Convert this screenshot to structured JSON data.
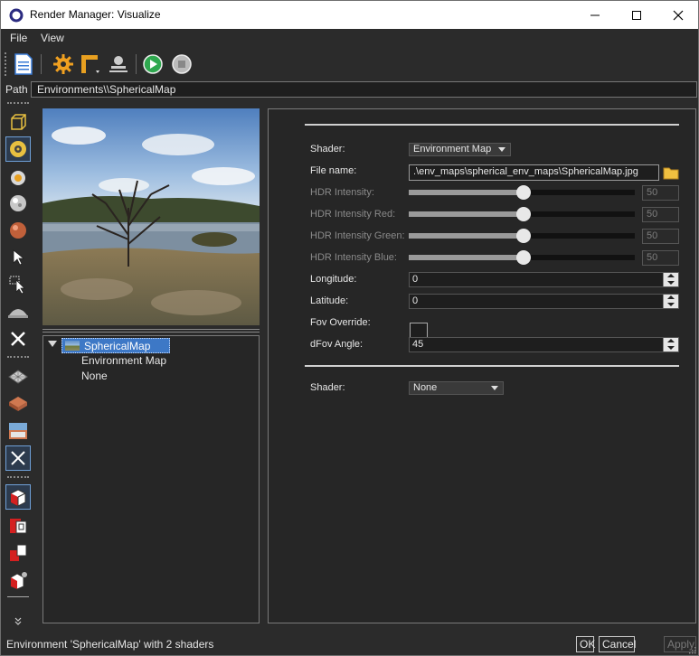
{
  "window": {
    "title": "Render Manager: Visualize",
    "minimize_glyph": "—",
    "maximize_glyph": "☐",
    "close_glyph": "✕"
  },
  "menu": {
    "file": "File",
    "view": "View"
  },
  "toolbar": {
    "icons": [
      "document-icon",
      "gear-icon",
      "frame-icon",
      "stamp-icon",
      "play-icon",
      "stop-icon"
    ]
  },
  "path": {
    "label": "Path",
    "value": "Environments\\\\SphericalMap"
  },
  "tree": {
    "root": "SphericalMap",
    "children": [
      "Environment Map",
      "None"
    ]
  },
  "properties": {
    "shader_label": "Shader:",
    "shader_value": "Environment Map",
    "filename_label": "File name:",
    "filename_value": ".\\env_maps\\spherical_env_maps\\SphericalMap.jpg",
    "hdr": [
      {
        "label": "HDR Intensity:",
        "value": "50",
        "fraction": 0.5
      },
      {
        "label": "HDR Intensity Red:",
        "value": "50",
        "fraction": 0.5
      },
      {
        "label": "HDR Intensity Green:",
        "value": "50",
        "fraction": 0.5
      },
      {
        "label": "HDR Intensity Blue:",
        "value": "50",
        "fraction": 0.5
      }
    ],
    "longitude_label": "Longitude:",
    "longitude_value": "0",
    "latitude_label": "Latitude:",
    "latitude_value": "0",
    "fov_override_label": "Fov Override:",
    "dfov_label": "dFov Angle:",
    "dfov_value": "45",
    "shader2_label": "Shader:",
    "shader2_value": "None"
  },
  "status": {
    "message": "Environment 'SphericalMap' with 2 shaders",
    "ok": "OK",
    "cancel": "Cancel",
    "apply": "Apply"
  },
  "colors": {
    "panel_bg": "#2b2b2b",
    "selection": "#3d78c6",
    "accent_orange": "#e8a020"
  }
}
